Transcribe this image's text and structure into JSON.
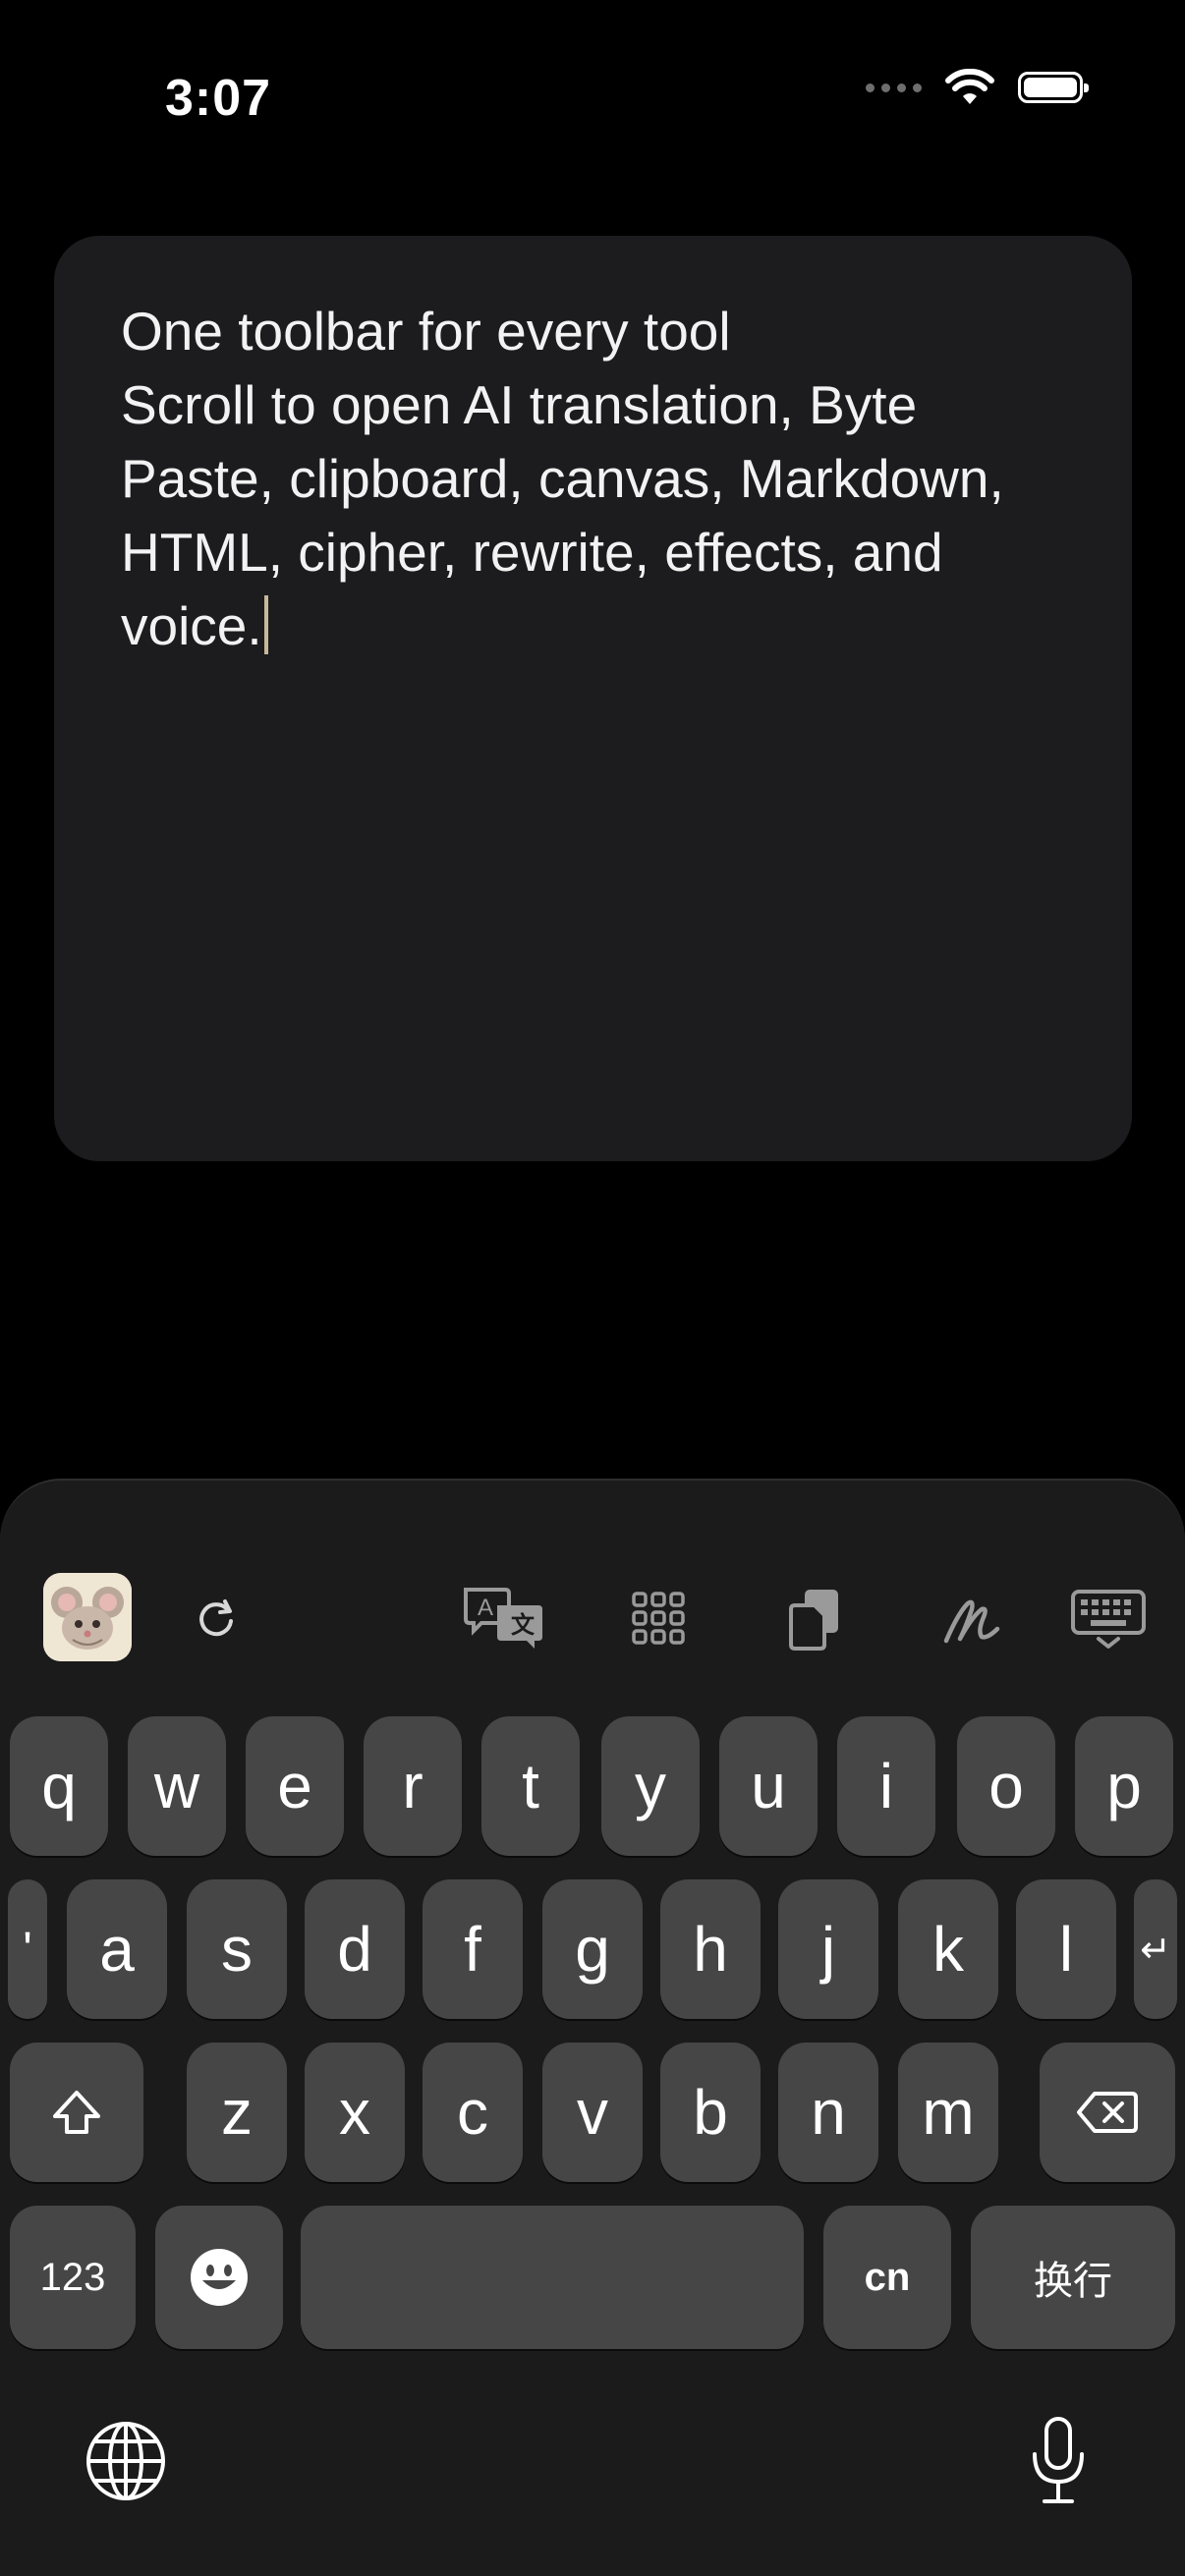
{
  "status": {
    "time": "3:07"
  },
  "editor": {
    "lines": [
      "One toolbar for every tool",
      "Scroll to open AI translation, Byte",
      "Paste, clipboard, canvas, Markdown,",
      "HTML, cipher, rewrite, effects, and",
      "voice."
    ]
  },
  "toolbar": {
    "icons": [
      "app-mouse-icon",
      "refresh-icon",
      "translate-icon",
      "grid-icon",
      "clipboard-icon",
      "scribble-icon",
      "keyboard-hide-icon"
    ]
  },
  "keys": {
    "row1": [
      "q",
      "w",
      "e",
      "r",
      "t",
      "y",
      "u",
      "i",
      "o",
      "p"
    ],
    "row2": [
      "'",
      "a",
      "s",
      "d",
      "f",
      "g",
      "h",
      "j",
      "k",
      "l",
      "↵"
    ],
    "row3": [
      "z",
      "x",
      "c",
      "v",
      "b",
      "n",
      "m"
    ],
    "numbers": "123",
    "lang": "cn",
    "return": "换行"
  },
  "colors": {
    "background": "#000000",
    "card": "#1c1c1e",
    "key": "#464646",
    "key_func": "#2c2c2c",
    "caret": "#c8b79a"
  }
}
